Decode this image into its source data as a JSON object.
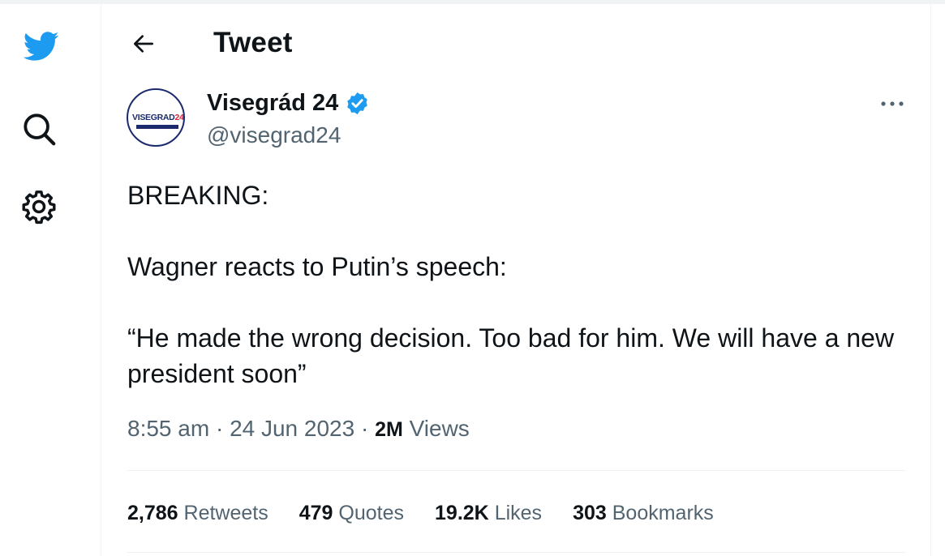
{
  "rail": {
    "logo_icon": "twitter-bird-icon",
    "search_icon": "search-icon",
    "settings_icon": "gear-icon"
  },
  "header": {
    "title": "Tweet",
    "back_icon": "arrow-left-icon"
  },
  "author": {
    "display_name": "Visegrád 24",
    "handle": "@visegrad24",
    "avatar_text_main": "VISEGRAD",
    "avatar_text_num": "24",
    "verified": true,
    "verified_color": "#1d9bf0"
  },
  "tweet": {
    "line1": "BREAKING:",
    "line2": "Wagner reacts to Putin’s speech:",
    "line3": "“He made the wrong decision. Too bad for him. We will have a new president soon”"
  },
  "meta": {
    "time": "8:55 am",
    "date": "24 Jun 2023",
    "views_count": "2M",
    "views_label": "Views"
  },
  "stats": {
    "retweets_count": "2,786",
    "retweets_label": "Retweets",
    "quotes_count": "479",
    "quotes_label": "Quotes",
    "likes_count": "19.2K",
    "likes_label": "Likes",
    "bookmarks_count": "303",
    "bookmarks_label": "Bookmarks"
  },
  "colors": {
    "accent": "#1d9bf0",
    "text": "#0f1419",
    "secondary": "#536471",
    "border": "#eff3f4"
  }
}
